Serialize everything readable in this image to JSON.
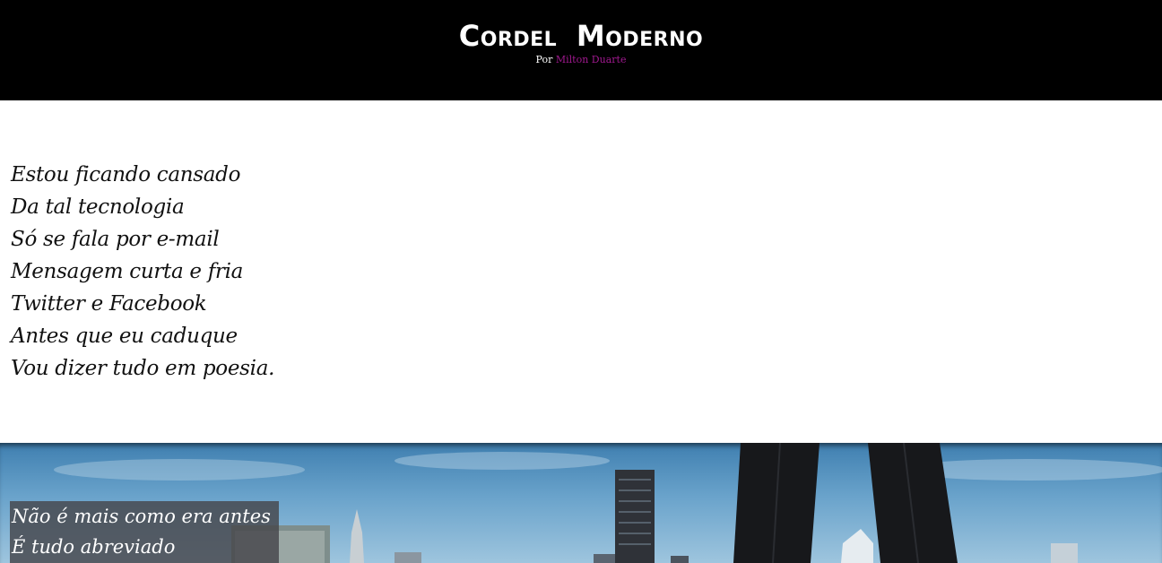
{
  "header": {
    "title": "Cordel Moderno",
    "by_prefix": "Por",
    "author": "Milton Duarte"
  },
  "poem": {
    "lines": [
      "Estou ficando cansado",
      "Da tal tecnologia",
      "Só se fala por e-mail",
      "Mensagem curta e fria",
      "Twitter e Facebook",
      "Antes que eu caduque",
      "Vou dizer tudo em poesia."
    ]
  },
  "photo_caption": {
    "lines": [
      "Não é mais como era antes",
      "É tudo abreviado"
    ]
  },
  "colors": {
    "header_bg": "#000000",
    "author_link": "#a0198f",
    "sky": "#6aa3cb"
  }
}
